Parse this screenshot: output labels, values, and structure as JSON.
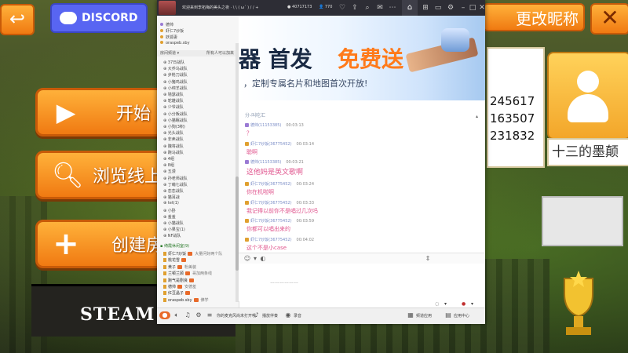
{
  "game": {
    "discord_label": "DISCORD",
    "rename_label": "更改昵称",
    "start_label": "开始",
    "browse_label": "浏览线上",
    "create_label": "创建房",
    "steam_label": "STEAM 游",
    "ids": [
      "245617",
      "163507",
      "231832"
    ],
    "nickname": "十三的墨颠"
  },
  "yy": {
    "title": "欢迎来到李拓梅的美头之夜 ·",
    "title_symbols": "\\ \\ ( ω´ ) / / +",
    "room_id": "40717173",
    "online_count": "770",
    "banner": {
      "title_plain": "器 首发",
      "title_highlight": "免费送",
      "subtitle": "，定制专属名片和地图首次开放!"
    },
    "side": {
      "top_members": [
        "德帅",
        "虾仁7炒饭",
        "妖狐妻"
      ],
      "top_member_extra": "oraspeb.sby",
      "category_label": "房间频道",
      "category_right": "所有人可以加来",
      "channels": [
        "37日战队",
        "大乔乌战队",
        "步枪刀战队",
        "小猪鸡战队",
        "小绵羊战队",
        "墙瑟战队",
        "鸵雄战队",
        "少爷战队",
        "小分叛战队",
        "小猫眠战队",
        "小狗(3积)",
        "光头战队",
        "非卖战队",
        "魏将战队",
        "跑马战队",
        "4组",
        "8组",
        "五漫",
        "孙老师战队",
        "丁萌七战队",
        "恋恋战队",
        "猫耳战",
        "tet(1)",
        "小卧",
        "羞羞",
        "小猫战队",
        "小果宝(1)",
        "NF战队"
      ],
      "lounge_label": "绮霞休闲室",
      "lounge_count": "(9)",
      "lounge_members": [
        "虾仁7炒饭",
        "桃花雪",
        "黄子",
        "兰顿兰顾",
        "跑气是剧良",
        "德帅",
        "红豆晶子",
        "oraspeb.sby"
      ],
      "lounge_notes": [
        "大量问好两个队",
        "",
        "粉美装",
        "哥加两条线",
        "",
        "安德羞",
        "",
        "佛学"
      ]
    },
    "chat": {
      "header": "分-叫吃汇",
      "messages": [
        {
          "user": "德帅(11153385)",
          "time": "00:03:13",
          "text": "？",
          "big": false
        },
        {
          "user": "虾仁7炒饭(36775452)",
          "time": "00:03:14",
          "text": "聪啊",
          "big": false
        },
        {
          "user": "德帅(11153385)",
          "time": "00:03:21",
          "text": "这他妈是英文歌啊",
          "big": true
        },
        {
          "user": "虾仁7炒饭(36775452)",
          "time": "00:03:24",
          "text": "你在机啦啊",
          "big": false
        },
        {
          "user": "虾仁7炒饭(36775452)",
          "time": "00:03:33",
          "text": "我记得以前你不是唱过几次吗",
          "big": false
        },
        {
          "user": "虾仁7炒饭(36775452)",
          "time": "00:03:59",
          "text": "你都可以唱出来的",
          "big": false
        },
        {
          "user": "虾仁7炒饭(36775452)",
          "time": "00:04:02",
          "text": "这个不是小case",
          "big": false
        }
      ]
    },
    "input_placeholder": "………………",
    "send_icon": "chat-bubble-icon",
    "bottom_bar": {
      "mic_label": "0:00",
      "bar_text": "你的麦克风尚未打开哦",
      "play_label": "播放伴奏",
      "record_label": "录音",
      "app_label": "频道应用",
      "app_center": "应用中心"
    }
  },
  "colors": {
    "orange": "#f07a12",
    "discord": "#5865f2",
    "chat_pink": "#e0558e",
    "title_bar": "#2d2d35"
  }
}
